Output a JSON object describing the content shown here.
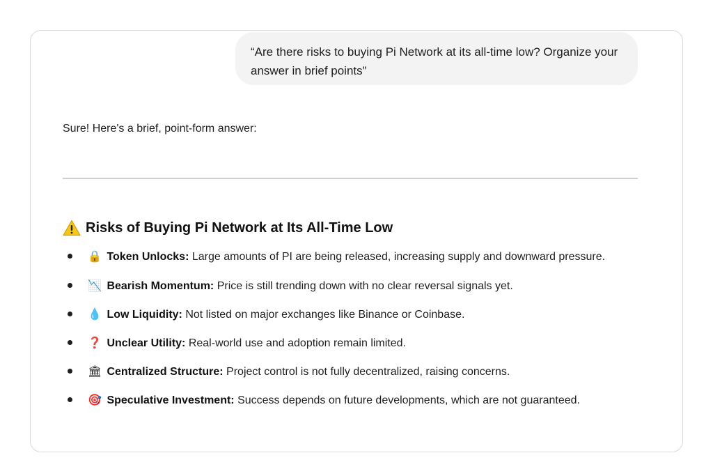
{
  "conversation": {
    "user_message": "“Are there risks to buying Pi Network at its all-time low? Organize your answer in brief points”",
    "intro_text": "Sure! Here's a brief, point-form answer:",
    "heading": "Risks of Buying Pi Network at Its All-Time Low",
    "heading_icon": "warning-icon",
    "risks": [
      {
        "icon": "lock-icon",
        "glyph": "🔒",
        "title": "Token Unlocks:",
        "text": "Large amounts of PI are being released, increasing supply and downward pressure."
      },
      {
        "icon": "chart-down-icon",
        "glyph": "📉",
        "title": "Bearish Momentum:",
        "text": "Price is still trending down with no clear reversal signals yet."
      },
      {
        "icon": "droplet-icon",
        "glyph": "💧",
        "title": "Low Liquidity:",
        "text": "Not listed on major exchanges like Binance or Coinbase."
      },
      {
        "icon": "question-icon",
        "glyph": "❓",
        "title": "Unclear Utility:",
        "text": "Real-world use and adoption remain limited."
      },
      {
        "icon": "bank-icon",
        "glyph": "🏛",
        "title": "Centralized Structure:",
        "text": "Project control is not fully decentralized, raising concerns."
      },
      {
        "icon": "target-icon",
        "glyph": "🎯",
        "title": "Speculative Investment:",
        "text": "Success depends on future developments, which are not guaranteed."
      }
    ],
    "colors": {
      "bubble_bg": "#f3f3f3",
      "warning_yellow": "#f5c518",
      "question_red": "#c62828",
      "target_red": "#e53935"
    }
  }
}
